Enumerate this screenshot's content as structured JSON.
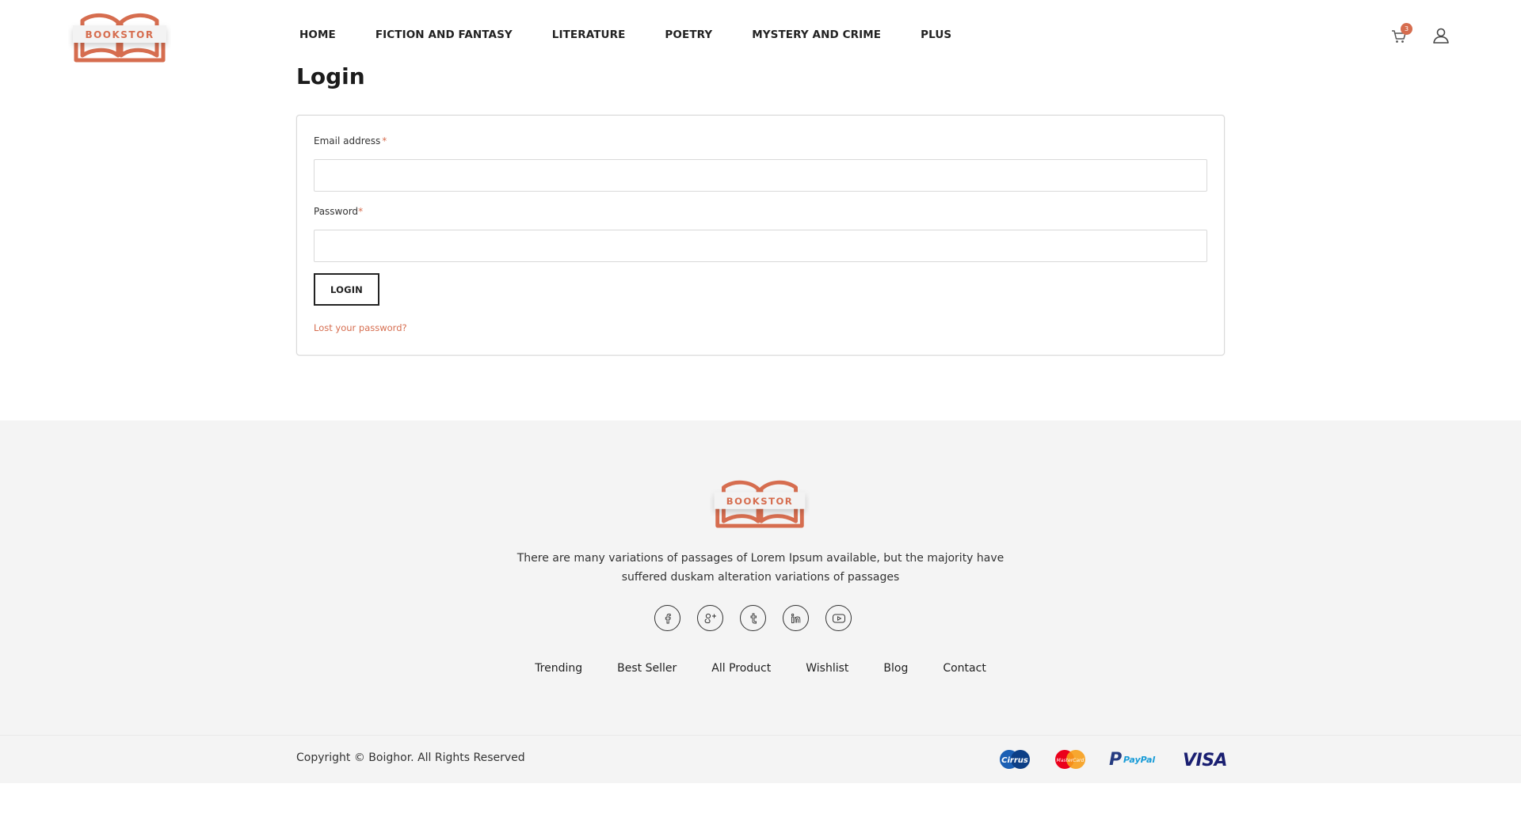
{
  "brand": {
    "name": "BOOKSTOR",
    "color": "#d66d4f"
  },
  "nav": {
    "items": [
      {
        "label": "HOME"
      },
      {
        "label": "FICTION AND FANTASY"
      },
      {
        "label": "LITERATURE"
      },
      {
        "label": "POETRY"
      },
      {
        "label": "MYSTERY AND CRIME"
      },
      {
        "label": "PLUS"
      }
    ]
  },
  "header": {
    "cart_icon": "cart-icon",
    "cart_count": "3",
    "user_icon": "user-icon"
  },
  "login": {
    "title": "Login",
    "email_label": "Email address",
    "email_required": "*",
    "email_value": "",
    "password_label": "Password",
    "password_required": "*",
    "password_value": "",
    "button_label": "LOGIN",
    "lost_password": "Lost your password?"
  },
  "footer": {
    "description": "There are many variations of passages of Lorem Ipsum available, but the majority have suffered duskam alteration variations of passages",
    "social": [
      {
        "icon": "facebook-icon"
      },
      {
        "icon": "google-plus-icon"
      },
      {
        "icon": "tumblr-icon"
      },
      {
        "icon": "linkedin-icon"
      },
      {
        "icon": "youtube-icon"
      }
    ],
    "links": [
      {
        "label": "Trending"
      },
      {
        "label": "Best Seller"
      },
      {
        "label": "All Product"
      },
      {
        "label": "Wishlist"
      },
      {
        "label": "Blog"
      },
      {
        "label": "Contact"
      }
    ],
    "copyright": "Copyright © Boighor. All Rights Reserved",
    "payments": [
      {
        "name": "Cirrus"
      },
      {
        "name": "MasterCard"
      },
      {
        "name": "PayPal"
      },
      {
        "name": "VISA"
      }
    ]
  }
}
